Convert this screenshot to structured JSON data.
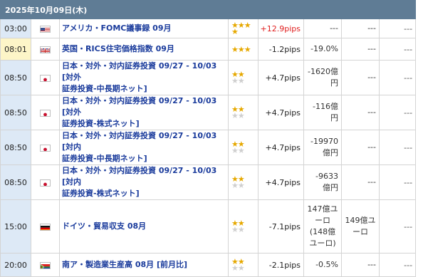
{
  "header": {
    "date": "2025年10月09日(木)"
  },
  "colors": {
    "star_on": "#e6a800",
    "star_off": "#cfcfcf"
  },
  "rows": [
    {
      "time": "03:00",
      "country": "us-flag",
      "event_line1": "アメリカ・FOMC議事録 09月",
      "event_line2": "",
      "stars_line1": "★★★",
      "stars_line2": "★",
      "stars_line2_off": "",
      "pips": "+12.9pips",
      "actual_line1": "---",
      "actual_line2": "",
      "actual_line3": "",
      "actual_line4": "",
      "forecast_line1": "---",
      "forecast_line2": "",
      "previous": "---"
    },
    {
      "time": "08:01",
      "country": "uk-flag",
      "event_line1": "英国・RICS住宅価格指数 09月",
      "event_line2": "",
      "stars_line1": "★★★",
      "stars_line2": "",
      "stars_line2_off": "",
      "pips": "-1.2pips",
      "actual_line1": "-19.0%",
      "actual_line2": "",
      "actual_line3": "",
      "actual_line4": "",
      "forecast_line1": "---",
      "forecast_line2": "",
      "previous": "---"
    },
    {
      "time": "08:50",
      "country": "jp-flag",
      "event_line1": "日本・対外・対内証券投資 09/27 - 10/03 [対外",
      "event_line2": "証券投資-中長期ネット]",
      "stars_line1": "★★",
      "stars_line2": "",
      "stars_line2_off": "★★",
      "pips": "+4.7pips",
      "actual_line1": "-1620億",
      "actual_line2": "円",
      "actual_line3": "",
      "actual_line4": "",
      "forecast_line1": "---",
      "forecast_line2": "",
      "previous": "---"
    },
    {
      "time": "08:50",
      "country": "jp-flag",
      "event_line1": "日本・対外・対内証券投資 09/27 - 10/03 [対外",
      "event_line2": "証券投資-株式ネット]",
      "stars_line1": "★★",
      "stars_line2": "",
      "stars_line2_off": "★★",
      "pips": "+4.7pips",
      "actual_line1": "-116億",
      "actual_line2": "円",
      "actual_line3": "",
      "actual_line4": "",
      "forecast_line1": "---",
      "forecast_line2": "",
      "previous": "---"
    },
    {
      "time": "08:50",
      "country": "jp-flag",
      "event_line1": "日本・対外・対内証券投資 09/27 - 10/03 [対内",
      "event_line2": "証券投資-中長期ネット]",
      "stars_line1": "★★",
      "stars_line2": "",
      "stars_line2_off": "★★",
      "pips": "+4.7pips",
      "actual_line1": "-19970",
      "actual_line2": "億円",
      "actual_line3": "",
      "actual_line4": "",
      "forecast_line1": "---",
      "forecast_line2": "",
      "previous": "---"
    },
    {
      "time": "08:50",
      "country": "jp-flag",
      "event_line1": "日本・対外・対内証券投資 09/27 - 10/03 [対内",
      "event_line2": "証券投資-株式ネット]",
      "stars_line1": "★★",
      "stars_line2": "",
      "stars_line2_off": "★★",
      "pips": "+4.7pips",
      "actual_line1": "-9633",
      "actual_line2": "億円",
      "actual_line3": "",
      "actual_line4": "",
      "forecast_line1": "---",
      "forecast_line2": "",
      "previous": "---"
    },
    {
      "time": "15:00",
      "country": "de-flag",
      "event_line1": "ドイツ・貿易収支 08月",
      "event_line2": "",
      "stars_line1": "★★",
      "stars_line2": "",
      "stars_line2_off": "★★",
      "pips": "-7.1pips",
      "actual_line1": "147億ユ",
      "actual_line2": "ーロ",
      "actual_line3": "(148億",
      "actual_line4": "ユーロ)",
      "forecast_line1": "149億ユ",
      "forecast_line2": "ーロ",
      "previous": "---"
    },
    {
      "time": "20:00",
      "country": "za-flag",
      "event_line1": "南ア・製造業生産高 08月 [前月比]",
      "event_line2": "",
      "stars_line1": "★★",
      "stars_line2": "",
      "stars_line2_off": "★★",
      "pips": "-2.1pips",
      "actual_line1": "-0.5%",
      "actual_line2": "",
      "actual_line3": "",
      "actual_line4": "",
      "forecast_line1": "---",
      "forecast_line2": "",
      "previous": "---"
    }
  ]
}
